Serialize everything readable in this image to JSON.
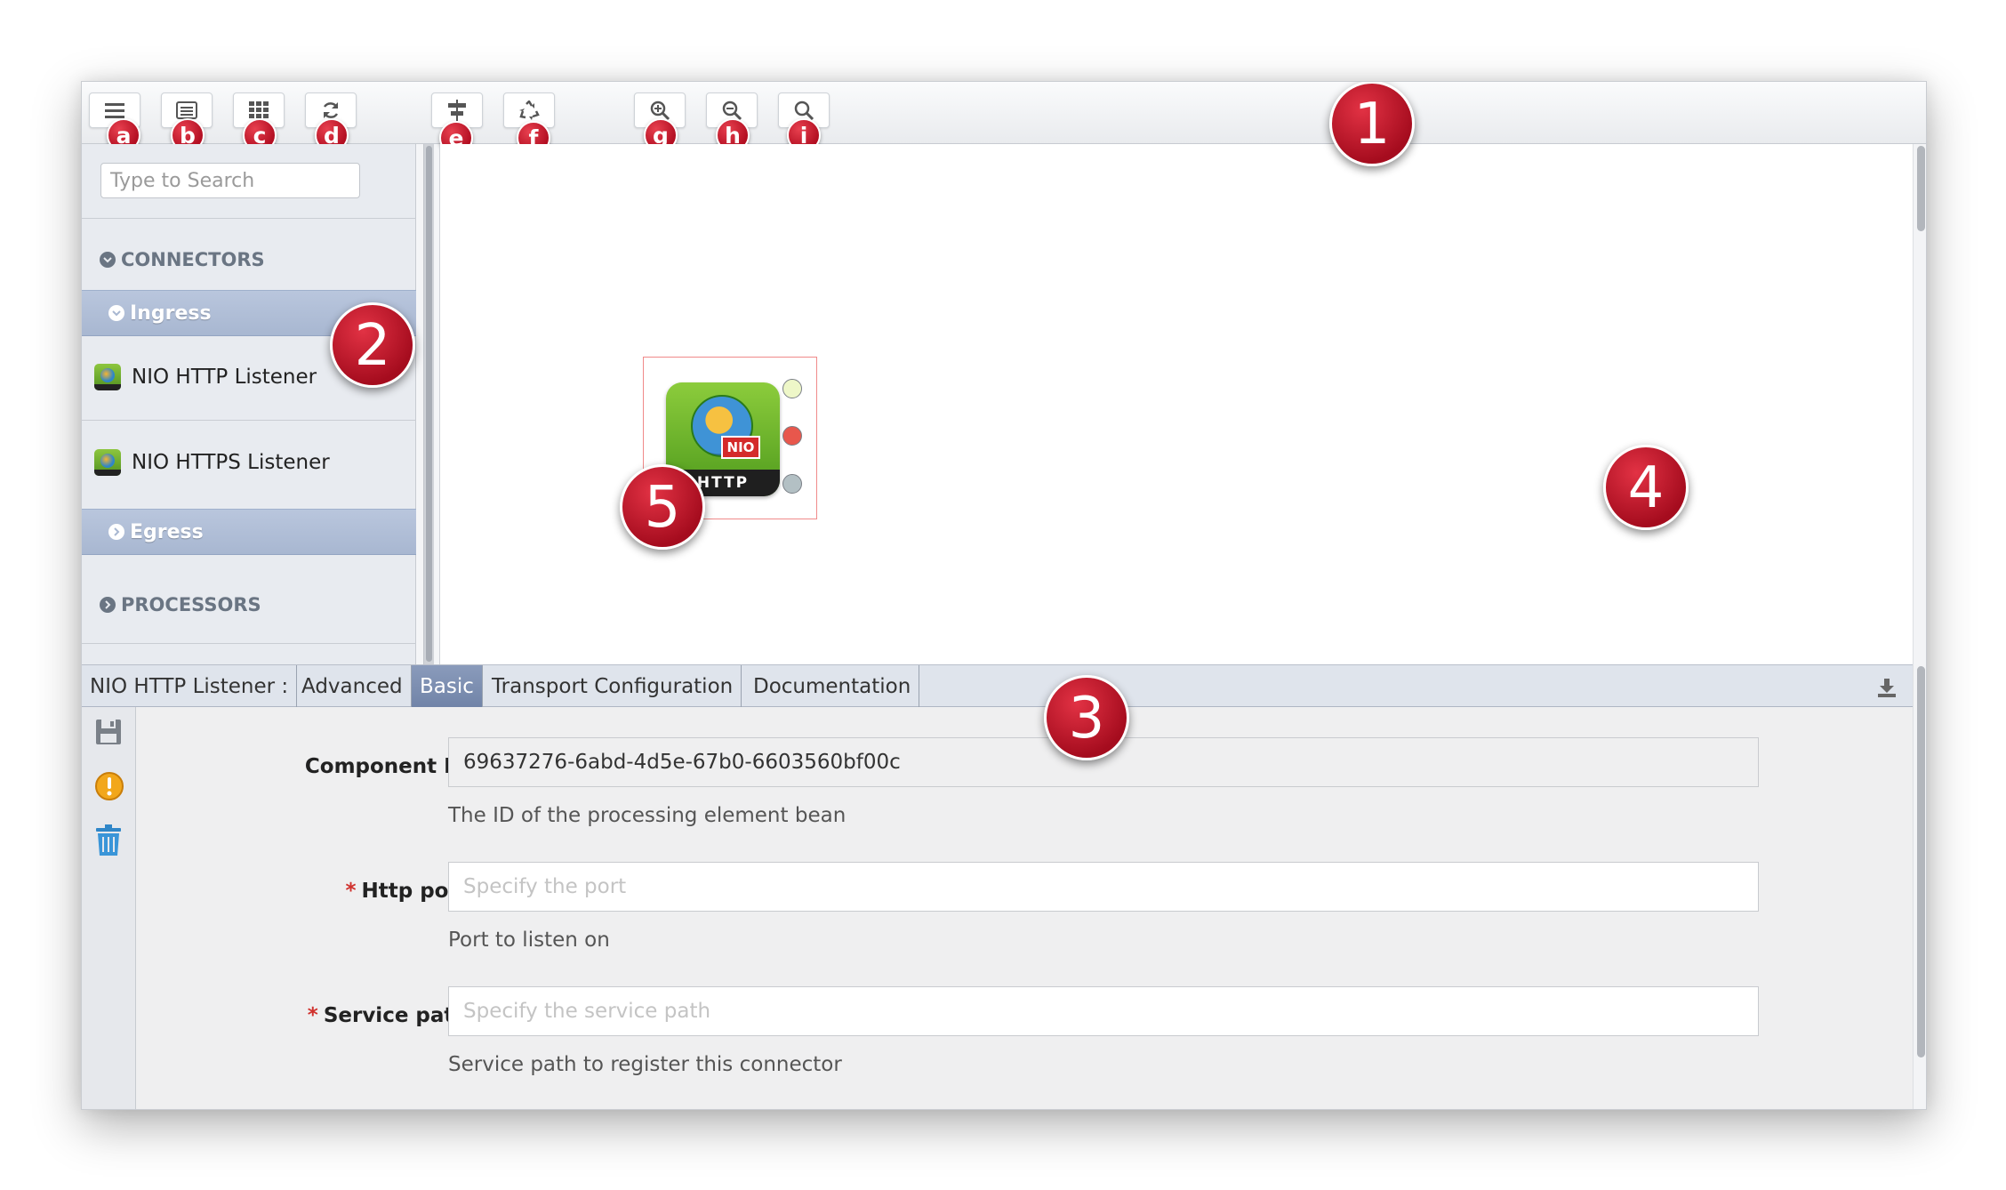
{
  "toolbar": {
    "buttons": [
      {
        "icon": "menu-icon",
        "badge": "a"
      },
      {
        "icon": "list-view-icon",
        "badge": "b"
      },
      {
        "icon": "grid-icon",
        "badge": "c"
      },
      {
        "icon": "refresh-icon",
        "badge": "d"
      },
      {
        "icon": "align-icon",
        "badge": "e"
      },
      {
        "icon": "recycle-icon",
        "badge": "f"
      },
      {
        "icon": "zoom-in-icon",
        "badge": "g"
      },
      {
        "icon": "zoom-out-icon",
        "badge": "h"
      },
      {
        "icon": "zoom-fit-icon",
        "badge": "i"
      }
    ]
  },
  "callouts": [
    "1",
    "2",
    "3",
    "4",
    "5"
  ],
  "sidebar": {
    "search_placeholder": "Type to Search",
    "connectors_label": "CONNECTORS",
    "ingress_label": "Ingress",
    "items": [
      {
        "label": "NIO HTTP Listener",
        "icon": "http-listener-icon"
      },
      {
        "label": "NIO HTTPS Listener",
        "icon": "https-listener-icon"
      }
    ],
    "egress_label": "Egress",
    "processors_label": "PROCESSORS"
  },
  "canvas": {
    "node": {
      "tag": "NIO",
      "label": "HTTP",
      "ports": [
        "#eef7c8",
        "#e8574c",
        "#b3c0c4"
      ]
    }
  },
  "properties": {
    "component_name": "NIO HTTP Listener :",
    "tabs": [
      "Advanced",
      "Basic",
      "Transport Configuration",
      "Documentation"
    ],
    "active_tab": "Basic",
    "fields": [
      {
        "label": "Component ID:",
        "required": false,
        "value": "69637276-6abd-4d5e-67b0-6603560bf00c",
        "placeholder": "",
        "help": "The ID of the processing element bean"
      },
      {
        "label": "Http port:",
        "required": true,
        "value": "",
        "placeholder": "Specify the port",
        "help": "Port to listen on"
      },
      {
        "label": "Service path:",
        "required": true,
        "value": "",
        "placeholder": "Specify the service path",
        "help": "Service path to register this connector"
      }
    ]
  },
  "colors": {
    "badge_red": "#b3122a",
    "group_header": "#aebcd5",
    "active_tab": "#7a8cae"
  }
}
